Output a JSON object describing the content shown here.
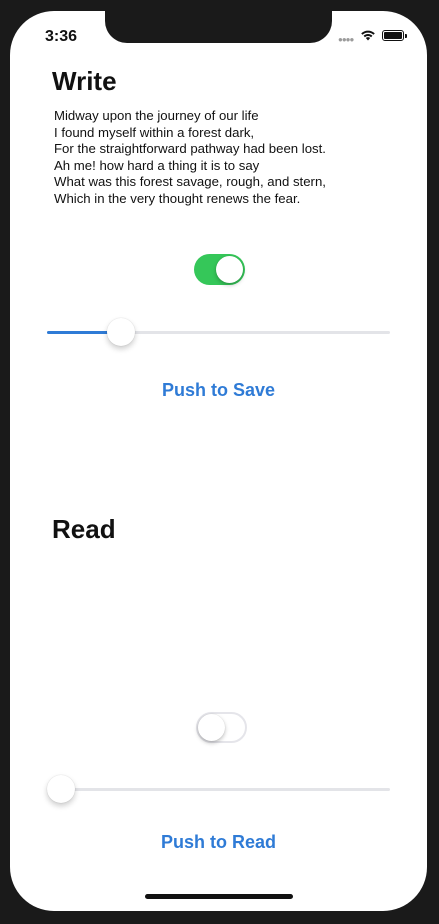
{
  "status_bar": {
    "time": "3:36"
  },
  "write": {
    "title": "Write",
    "poem_lines": [
      "Midway upon the journey of our life",
      "I found myself within a forest dark,",
      "For the straightforward pathway had been lost.",
      "Ah me! how hard a thing it is to say",
      "What was this forest savage, rough, and stern,",
      "Which in the very thought renews the fear."
    ],
    "toggle_on": true,
    "slider_value": 0.19,
    "button_label": "Push to Save"
  },
  "read": {
    "title": "Read",
    "toggle_on": false,
    "slider_value": 0.0,
    "button_label": "Push to Read"
  },
  "colors": {
    "accent": "#2f7bd6",
    "toggle_on": "#35c759",
    "track": "#e3e4e8"
  }
}
